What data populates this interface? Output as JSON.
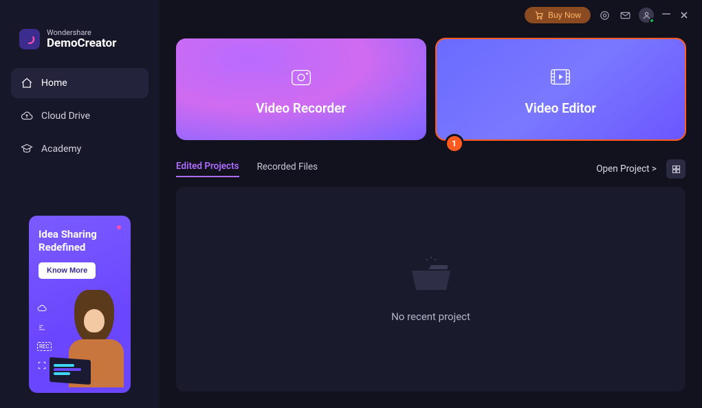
{
  "brand": {
    "company": "Wondershare",
    "product": "DemoCreator"
  },
  "sidebar": {
    "items": [
      {
        "label": "Home"
      },
      {
        "label": "Cloud Drive"
      },
      {
        "label": "Academy"
      }
    ]
  },
  "promo": {
    "title_line1": "Idea Sharing",
    "title_line2": "Redefined",
    "cta": "Know More",
    "rec_label": "REC"
  },
  "titlebar": {
    "buy_label": "Buy Now"
  },
  "modes": {
    "recorder": "Video Recorder",
    "editor": "Video Editor",
    "editor_badge": "1"
  },
  "tabs": {
    "edited": "Edited Projects",
    "recorded": "Recorded Files"
  },
  "actions": {
    "open_project": "Open Project  >"
  },
  "empty_state": {
    "message": "No recent project"
  }
}
